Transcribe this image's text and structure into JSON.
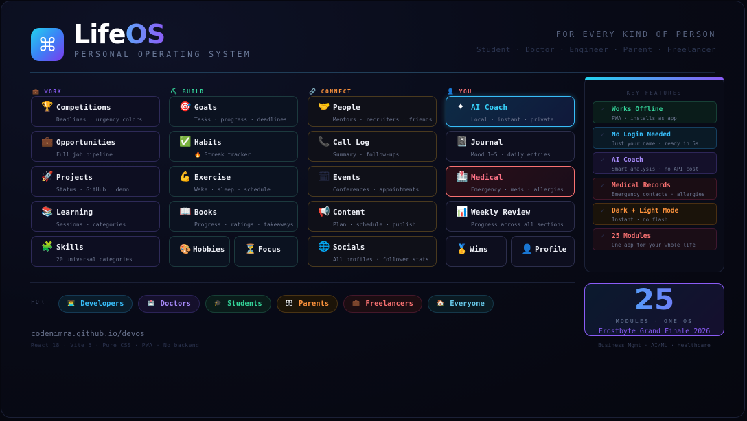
{
  "header": {
    "logo_icon": "command-icon",
    "logo_glyph": "⌘",
    "brand_part1": "Life",
    "brand_part2": "OS",
    "tagline": "PERSONAL OPERATING SYSTEM",
    "right_title": "FOR EVERY KIND OF PERSON",
    "right_sub": "Student · Doctor · Engineer · Parent · Freelancer"
  },
  "columns": {
    "work": {
      "label": "WORK",
      "icon": "briefcase-icon",
      "glyph": "💼",
      "color": "#8b5cf6",
      "cards": [
        {
          "icon": "trophy-icon",
          "glyph": "🏆",
          "title": "Competitions",
          "sub": "Deadlines · urgency colors"
        },
        {
          "icon": "briefcase-icon",
          "glyph": "💼",
          "title": "Opportunities",
          "sub": "Full job pipeline"
        },
        {
          "icon": "rocket-icon",
          "glyph": "🚀",
          "title": "Projects",
          "sub": "Status · GitHub · demo"
        },
        {
          "icon": "books-icon",
          "glyph": "📚",
          "title": "Learning",
          "sub": "Sessions · categories"
        },
        {
          "icon": "puzzle-icon",
          "glyph": "🧩",
          "title": "Skills",
          "sub": "20 universal categories"
        }
      ]
    },
    "build": {
      "label": "BUILD",
      "icon": "hammer-icon",
      "glyph": "⛏",
      "color": "#34d399",
      "cards": [
        {
          "icon": "target-icon",
          "glyph": "🎯",
          "title": "Goals",
          "sub": "Tasks · progress · deadlines"
        },
        {
          "icon": "checkbox-icon",
          "glyph": "✅",
          "title": "Habits",
          "sub": "🔥 Streak tracker"
        },
        {
          "icon": "flexed-arm-icon",
          "glyph": "💪",
          "title": "Exercise",
          "sub": "Wake · sleep · schedule"
        },
        {
          "icon": "book-icon",
          "glyph": "📖",
          "title": "Books",
          "sub": "Progress · ratings · takeaways"
        }
      ],
      "half_cards": [
        {
          "icon": "palette-icon",
          "glyph": "🎨",
          "title": "Hobbies"
        },
        {
          "icon": "hourglass-icon",
          "glyph": "⏳",
          "title": "Focus"
        }
      ]
    },
    "connect": {
      "label": "CONNECT",
      "icon": "link-icon",
      "glyph": "🔗",
      "color": "#fb923c",
      "cards": [
        {
          "icon": "handshake-icon",
          "glyph": "🤝",
          "title": "People",
          "sub": "Mentors · recruiters · friends"
        },
        {
          "icon": "phone-icon",
          "glyph": "📞",
          "title": "Call Log",
          "sub": "Summary · follow-ups"
        },
        {
          "icon": "calendar-icon",
          "glyph": "🗓",
          "title": "Events",
          "sub": "Conferences · appointments"
        },
        {
          "icon": "megaphone-icon",
          "glyph": "📢",
          "title": "Content",
          "sub": "Plan · schedule · publish"
        },
        {
          "icon": "globe-icon",
          "glyph": "🌐",
          "title": "Socials",
          "sub": "All profiles · follower stats"
        }
      ]
    },
    "you": {
      "label": "YOU",
      "icon": "person-icon",
      "glyph": "👤",
      "color": "#f87171",
      "cards": [
        {
          "icon": "sparkle-icon",
          "glyph": "✦",
          "title": "AI Coach",
          "sub": "Local · instant · private"
        },
        {
          "icon": "notebook-icon",
          "glyph": "📓",
          "title": "Journal",
          "sub": "Mood 1–5 · daily entries"
        },
        {
          "icon": "hospital-icon",
          "glyph": "🏥",
          "title": "Medical",
          "sub": "Emergency · meds · allergies"
        },
        {
          "icon": "bar-chart-icon",
          "glyph": "📊",
          "title": "Weekly Review",
          "sub": "Progress across all sections"
        }
      ],
      "half_cards": [
        {
          "icon": "medal-icon",
          "glyph": "🥇",
          "title": "Wins"
        },
        {
          "icon": "bust-icon",
          "glyph": "👤",
          "title": "Profile"
        }
      ]
    }
  },
  "features": {
    "title": "KEY FEATURES",
    "check_glyph": "✓",
    "items": [
      {
        "title": "Works Offline",
        "sub": "PWA · installs as app"
      },
      {
        "title": "No Login Needed",
        "sub": "Just your name · ready in 5s"
      },
      {
        "title": "AI Coach",
        "sub": "Smart analysis · no API cost"
      },
      {
        "title": "Medical Records",
        "sub": "Emergency contacts · allergies"
      },
      {
        "title": "Dark + Light Mode",
        "sub": "Instant · no flash"
      },
      {
        "title": "25 Modules",
        "sub": "One app for your whole life"
      }
    ]
  },
  "stats": {
    "number": "25",
    "label": "MODULES · ONE OS",
    "event": "Frostbyte Grand Finale 2026",
    "tracks": "Business Mgmt · AI/ML · Healthcare"
  },
  "audience": {
    "label": "FOR",
    "pills": [
      {
        "icon": "developer-icon",
        "glyph": "👨‍💻",
        "label": "Developers"
      },
      {
        "icon": "doctor-icon",
        "glyph": "🏥",
        "label": "Doctors"
      },
      {
        "icon": "graduation-cap-icon",
        "glyph": "🎓",
        "label": "Students"
      },
      {
        "icon": "family-icon",
        "glyph": "👨‍👩‍👧",
        "label": "Parents"
      },
      {
        "icon": "briefcase-icon",
        "glyph": "💼",
        "label": "Freelancers"
      },
      {
        "icon": "house-icon",
        "glyph": "🏠",
        "label": "Everyone"
      }
    ]
  },
  "footer": {
    "url": "codenimra.github.io/devos",
    "stack": "React 18 · Vite 5 · Pure CSS · PWA · No backend"
  }
}
